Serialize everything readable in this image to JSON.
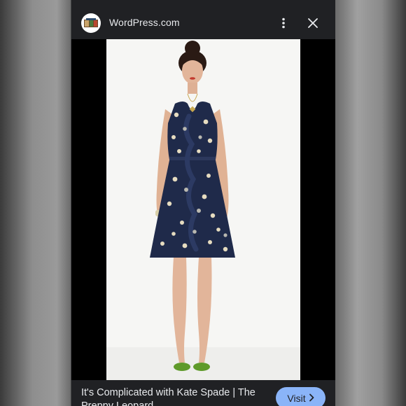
{
  "header": {
    "site_name": "WordPress.com",
    "favicon": "site-favicon",
    "more_icon": "more-vertical-icon",
    "close_icon": "close-icon"
  },
  "image": {
    "subject": "woman-in-navy-polka-dot-dress-photo"
  },
  "footer": {
    "caption": "It's Complicated with Kate Spade | The Preppy Leopard",
    "visit_label": "Visit",
    "visit_icon": "chevron-right-icon"
  },
  "colors": {
    "panel_bg": "#202124",
    "text": "#e8eaed",
    "accent": "#8ab4f8",
    "dress": "#1f2a4a"
  }
}
